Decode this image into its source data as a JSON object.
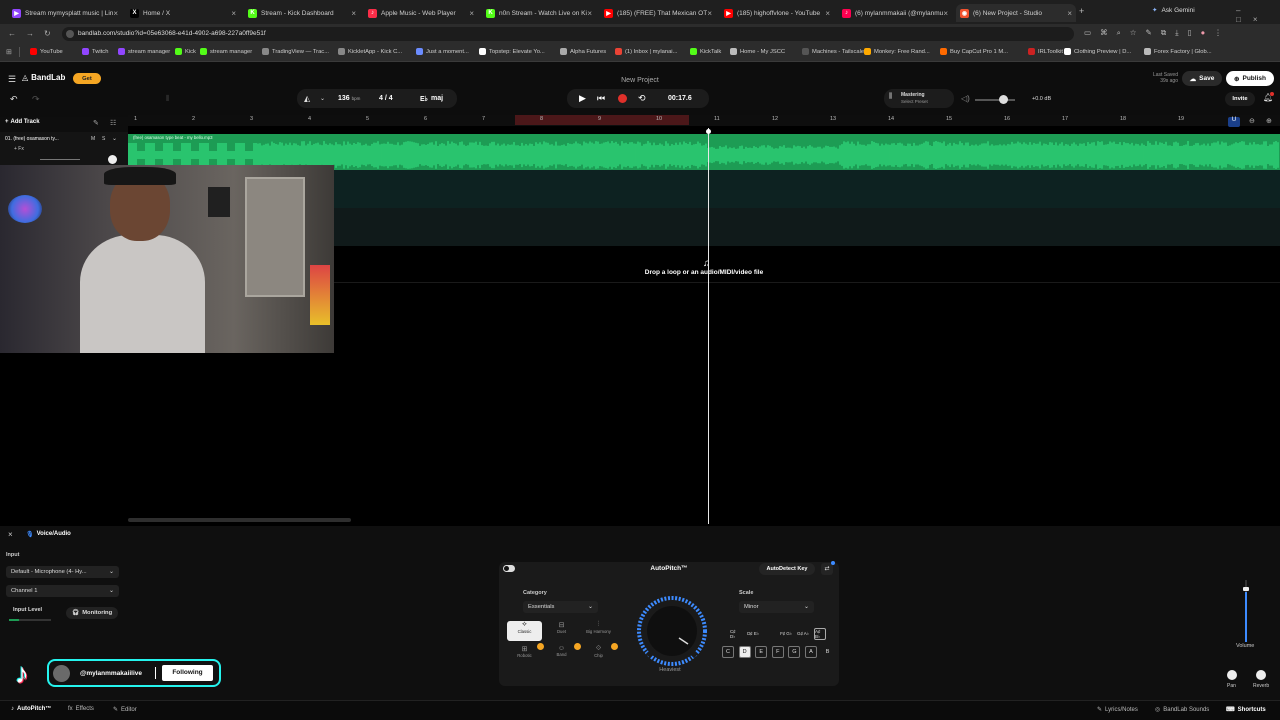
{
  "browser": {
    "tabs": [
      {
        "title": "Stream mymysplatt music | Lin",
        "color": "#9146ff",
        "glyph": "▶"
      },
      {
        "title": "Home / X",
        "color": "#000000",
        "glyph": "X"
      },
      {
        "title": "Stream - Kick Dashboard",
        "color": "#53fc18",
        "glyph": "K"
      },
      {
        "title": "Apple Music - Web Player",
        "color": "#fa2d48",
        "glyph": "♪"
      },
      {
        "title": "n0n Stream - Watch Live on Ki",
        "color": "#53fc18",
        "glyph": "K"
      },
      {
        "title": "(185) (FREE) That Mexican OT",
        "color": "#ff0000",
        "glyph": "▶"
      },
      {
        "title": "(185) highoffvlone - YouTube",
        "color": "#ff0000",
        "glyph": "▶"
      },
      {
        "title": "(6) mylanmmakaii (@mylanmu",
        "color": "#ff0050",
        "glyph": "♪"
      },
      {
        "title": "(6) New Project - Studio",
        "color": "#f2522e",
        "glyph": "◉"
      }
    ],
    "ask_gemini": "Ask Gemini",
    "url": "bandlab.com/studio?id=05e63068-e41d-4902-a698-227a0ff9e51f",
    "bookmarks": [
      {
        "label": "YouTube",
        "color": "#ff0000"
      },
      {
        "label": "Twitch",
        "color": "#9146ff"
      },
      {
        "label": "stream manager",
        "color": "#9146ff"
      },
      {
        "label": "Kick",
        "color": "#53fc18"
      },
      {
        "label": "stream manager",
        "color": "#53fc18"
      },
      {
        "label": "TradingView — Trac...",
        "color": "#888888"
      },
      {
        "label": "KickletApp - Kick C...",
        "color": "#888888"
      },
      {
        "label": "Just a moment...",
        "color": "#6b8cff"
      },
      {
        "label": "Topstep: Elevate Yo...",
        "color": "#ffffff"
      },
      {
        "label": "Alpha Futures",
        "color": "#aaaaaa"
      },
      {
        "label": "(1) Inbox | mylanai...",
        "color": "#ea4335"
      },
      {
        "label": "KickTalk",
        "color": "#53fc18"
      },
      {
        "label": "Home - My JSCC",
        "color": "#bbbbbb"
      },
      {
        "label": "Machines - Tailscale",
        "color": "#555555"
      },
      {
        "label": "Monkey: Free Rand...",
        "color": "#ffaa00"
      },
      {
        "label": "Buy CapCut Pro 1 M...",
        "color": "#ff6a00"
      },
      {
        "label": "IRLToolkit",
        "color": "#cc2222"
      },
      {
        "label": "Clothing Preview | D...",
        "color": "#ffffff"
      },
      {
        "label": "Forex Factory | Glob...",
        "color": "#bbbbbb"
      }
    ]
  },
  "header": {
    "logo": "BandLab",
    "get_badge": "Get",
    "project_title": "New Project",
    "last_saved_label": "Last Saved",
    "last_saved_time": "39s ago",
    "save": "Save",
    "publish": "Publish",
    "invite": "Invite"
  },
  "transport": {
    "bpm": "136",
    "bpm_unit": "bpm",
    "time_signature": "4 / 4",
    "key": "maj",
    "time": "00:17.6",
    "mastering": "Mastering",
    "select_preset": "Select Preset",
    "volume_db": "+0.0 dB"
  },
  "timeline": {
    "add_track": "Add Track",
    "bars": [
      "1",
      "2",
      "3",
      "4",
      "5",
      "6",
      "7",
      "8",
      "9",
      "10",
      "11",
      "12",
      "13",
      "14",
      "15",
      "16",
      "17",
      "18",
      "19"
    ],
    "track": {
      "name": "01. (free) osamason ty...",
      "fx": "+ Fx",
      "m": "M",
      "s": "S"
    },
    "clip_name": "(free) osamason type beat - my bello.mp3",
    "drop_hint": "Drop a loop or an audio/MIDI/video file"
  },
  "bottom_panel": {
    "title": "Voice/Audio",
    "input_label": "Input",
    "input_device": "Default - Microphone (4- Hy...",
    "channel": "Channel 1",
    "input_level": "Input Level",
    "monitoring": "Monitoring",
    "autopitch": {
      "title": "AutoPitch™",
      "autodetect": "AutoDetect Key",
      "category_label": "Category",
      "category_value": "Essentials",
      "scale_label": "Scale",
      "scale_value": "Minor",
      "presets": [
        "Classic",
        "Duet",
        "Big Harmony",
        "Robotic",
        "Band",
        "Chip"
      ],
      "knob_label": "Heaviest",
      "sharps": [
        "C♯ D♭",
        "D♯ E♭",
        "F♯ G♭",
        "G♯ A♭",
        "A♯ B♭"
      ],
      "naturals": [
        "C",
        "D",
        "E",
        "F",
        "G",
        "A",
        "B"
      ]
    },
    "volume": "Volume",
    "pan": "Pan",
    "reverb": "Reverb"
  },
  "stream_overlay": {
    "handle": "@mylanmmakaiilive",
    "following": "Following"
  },
  "bottom_bar": {
    "autopitch": "AutoPitch™",
    "effects": "Effects",
    "editor": "Editor",
    "lyrics": "Lyrics/Notes",
    "sounds": "BandLab Sounds",
    "shortcuts": "Shortcuts"
  },
  "colors": {
    "accent_green": "#1d9c54",
    "wave_green": "#2fd67a",
    "record_red": "#e0302a",
    "orange_badge": "#f5a623",
    "autopitch_blue": "#3d8bff"
  }
}
